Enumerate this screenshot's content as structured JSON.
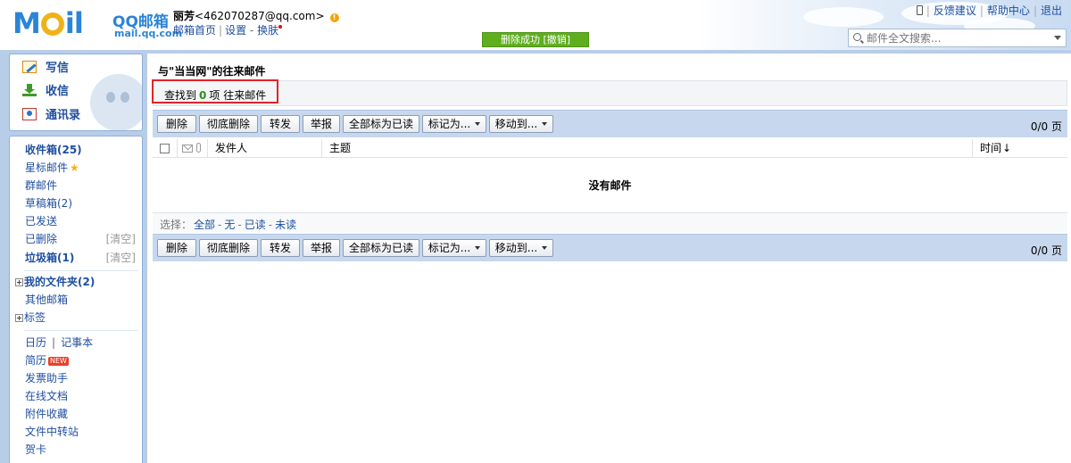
{
  "header": {
    "logo_text": "M   il",
    "logo_brand": "QQ邮箱",
    "logo_url": "mail.qq.com",
    "user_name": "丽芳",
    "user_email": "<462070287@qq.com>",
    "links": {
      "home": "邮箱首页",
      "settings": "设置",
      "dash": "-",
      "skin": "换肤",
      "sep": "|"
    },
    "top_links": [
      "反馈建议",
      "帮助中心",
      "退出"
    ],
    "toast": "删除成功 [撤销]",
    "search_placeholder": "邮件全文搜索..."
  },
  "quick": {
    "write": "写信",
    "receive": "收信",
    "contacts": "通讯录"
  },
  "folders": {
    "inbox": "收件箱(25)",
    "starred": "星标邮件",
    "group": "群邮件",
    "drafts": "草稿箱(2)",
    "sent": "已发送",
    "deleted": "已删除",
    "clear": "[清空]",
    "spam": "垃圾箱(1)",
    "my_folders": "我的文件夹(2)",
    "other_mail": "其他邮箱",
    "tags": "标签",
    "calendar": "日历",
    "notes": "记事本",
    "pipe": "|",
    "resume": "简历",
    "new_badge": "NEW",
    "invoice": "发票助手",
    "online_docs": "在线文档",
    "attachments": "附件收藏",
    "transfer": "文件中转站",
    "greeting": "贺卡"
  },
  "main": {
    "title": "与\"当当网\"的往来邮件",
    "found_prefix": "查找到",
    "found_count": "0",
    "found_suffix": "项 往来邮件",
    "toolbar": {
      "delete": "删除",
      "perm_delete": "彻底删除",
      "forward": "转发",
      "report": "举报",
      "mark_all_read": "全部标为已读",
      "mark_as": "标记为...",
      "move_to": "移动到...",
      "pager": "0/0 页"
    },
    "columns": {
      "sender": "发件人",
      "subject": "主题",
      "time": "时间",
      "sort_arrow": "↓"
    },
    "empty": "没有邮件",
    "select": {
      "label": "选择：",
      "all": "全部",
      "none": "无",
      "read": "已读",
      "unread": "未读",
      "sep": "-"
    }
  }
}
